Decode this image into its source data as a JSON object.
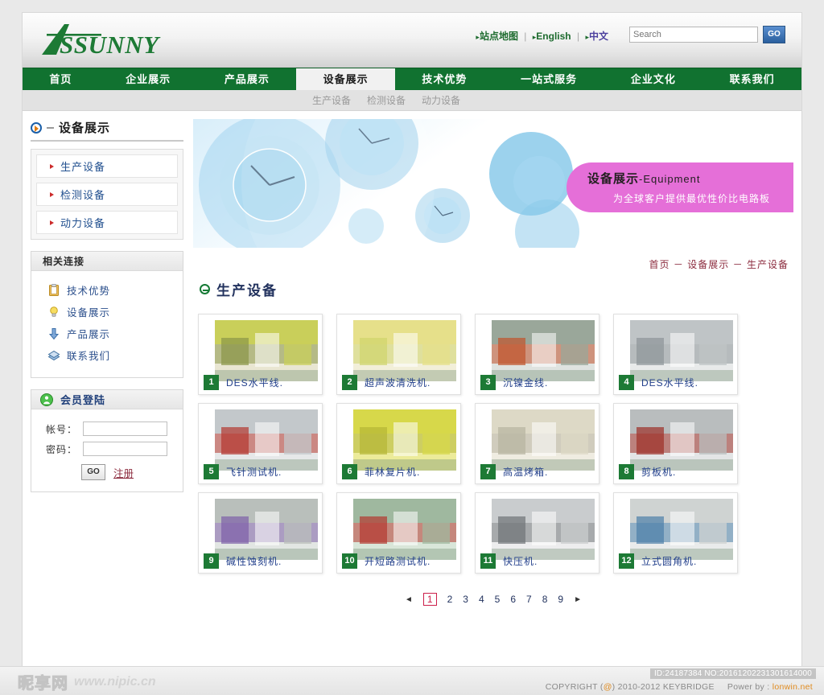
{
  "brand": {
    "name": "ASSUNNY"
  },
  "header": {
    "toplinks": [
      {
        "label": "站点地图",
        "kind": "cn"
      },
      {
        "label": "English",
        "kind": "en"
      },
      {
        "label": "中文",
        "kind": "cn2"
      }
    ],
    "search": {
      "placeholder": "Search",
      "value": "",
      "button": "GO"
    }
  },
  "mainnav": {
    "items": [
      {
        "label": "首页",
        "active": false
      },
      {
        "label": "企业展示",
        "active": false
      },
      {
        "label": "产品展示",
        "active": false
      },
      {
        "label": "设备展示",
        "active": true
      },
      {
        "label": "技术优势",
        "active": false
      },
      {
        "label": "一站式服务",
        "active": false
      },
      {
        "label": "企业文化",
        "active": false
      },
      {
        "label": "联系我们",
        "active": false
      }
    ]
  },
  "subnav": {
    "items": [
      "生产设备",
      "检测设备",
      "动力设备"
    ]
  },
  "sidebar": {
    "title": "设备展示",
    "items": [
      "生产设备",
      "检测设备",
      "动力设备"
    ],
    "links_panel": {
      "title": "相关连接",
      "items": [
        {
          "label": "技术优势",
          "icon": "clipboard-icon"
        },
        {
          "label": "设备展示",
          "icon": "lightbulb-icon"
        },
        {
          "label": "产品展示",
          "icon": "download-arrow-icon"
        },
        {
          "label": "联系我们",
          "icon": "books-icon"
        }
      ]
    },
    "login_panel": {
      "title": "会员登陆",
      "account_label": "帐号：",
      "account_value": "",
      "password_label": "密码：",
      "password_value": "",
      "go_button": "GO",
      "register_link": "注册"
    }
  },
  "banner": {
    "title_cn": "设备展示",
    "title_en": "-Equipment",
    "subtitle": "为全球客户提供最优性价比电路板",
    "bubble_color": "#e56fd8"
  },
  "breadcrumb": {
    "items": [
      "首页",
      "设备展示",
      "生产设备"
    ],
    "separator": "－"
  },
  "section": {
    "title": "生产设备"
  },
  "products": [
    {
      "num": "1",
      "name": "DES水平线.",
      "c1": "#c9cf5a",
      "c2": "#8a9647",
      "c3": "#e9e6d2"
    },
    {
      "num": "2",
      "name": "超声波清洗机.",
      "c1": "#e6e08a",
      "c2": "#cfd46b",
      "c3": "#f2efd9"
    },
    {
      "num": "3",
      "name": "沉镍金线.",
      "c1": "#9aa79a",
      "c2": "#c0522b",
      "c3": "#dfe3e0"
    },
    {
      "num": "4",
      "name": "DES水平线.",
      "c1": "#bfc4c6",
      "c2": "#8d9498",
      "c3": "#e8eaea"
    },
    {
      "num": "5",
      "name": "飞针测试机.",
      "c1": "#c3c8cb",
      "c2": "#b4382f",
      "c3": "#e6e8e9"
    },
    {
      "num": "6",
      "name": "菲林复片机.",
      "c1": "#d7d84a",
      "c2": "#b5b634",
      "c3": "#eceb9a"
    },
    {
      "num": "7",
      "name": "高温烤箱.",
      "c1": "#ddd9c6",
      "c2": "#b7b3a0",
      "c3": "#efece1"
    },
    {
      "num": "8",
      "name": "剪板机.",
      "c1": "#b9bdbe",
      "c2": "#9c2f27",
      "c3": "#e3e5e6"
    },
    {
      "num": "9",
      "name": "碱性蚀刻机.",
      "c1": "#b9bfbb",
      "c2": "#7d5fa8",
      "c3": "#e2e6e3"
    },
    {
      "num": "10",
      "name": "开短路测试机.",
      "c1": "#9fb89f",
      "c2": "#b4382f",
      "c3": "#d9e6d9"
    },
    {
      "num": "11",
      "name": "快压机.",
      "c1": "#c9ccce",
      "c2": "#6d7276",
      "c3": "#ededee"
    },
    {
      "num": "12",
      "name": "立式圆角机.",
      "c1": "#cfd3d2",
      "c2": "#4b7fa8",
      "c3": "#e9ebeb"
    }
  ],
  "pager": {
    "first": "◄",
    "last": "►",
    "pages": [
      "1",
      "2",
      "3",
      "4",
      "5",
      "6",
      "7",
      "8",
      "9"
    ],
    "current": "1"
  },
  "footer": {
    "watermark_cn": "昵享网",
    "watermark_url": "www.nipic.cn",
    "id_tag": "ID:24187384 NO:20161202231301614000",
    "copyright_prefix": "COPYRIGHT (",
    "copyright_at": "@",
    "copyright_suffix": ") 2010-2012 KEYBRIDGE",
    "powerby_label": "Power by :",
    "powerby_site": "lonwin.net"
  }
}
